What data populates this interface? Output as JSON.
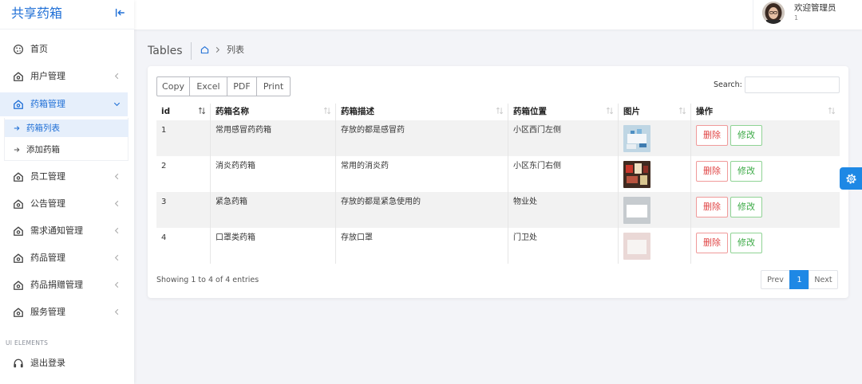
{
  "brand": {
    "title": "共享药箱"
  },
  "sidebar": {
    "items": [
      {
        "label": "首页",
        "icon": "palette-icon",
        "has_submenu": false
      },
      {
        "label": "用户管理",
        "icon": "home-icon",
        "has_submenu": true
      },
      {
        "label": "药箱管理",
        "icon": "home-icon",
        "has_submenu": true,
        "active": true,
        "expanded": true,
        "children": [
          {
            "label": "药箱列表",
            "active": true
          },
          {
            "label": "添加药箱",
            "active": false
          }
        ]
      },
      {
        "label": "员工管理",
        "icon": "home-icon",
        "has_submenu": true
      },
      {
        "label": "公告管理",
        "icon": "home-icon",
        "has_submenu": true
      },
      {
        "label": "需求通知管理",
        "icon": "home-icon",
        "has_submenu": true
      },
      {
        "label": "药品管理",
        "icon": "home-icon",
        "has_submenu": true
      },
      {
        "label": "药品捐赠管理",
        "icon": "home-icon",
        "has_submenu": true
      },
      {
        "label": "服务管理",
        "icon": "home-icon",
        "has_submenu": true
      }
    ],
    "section_label": "UI ELEMENTS",
    "logout": {
      "label": "退出登录",
      "icon": "headphones-icon"
    }
  },
  "header": {
    "welcome": "欢迎管理员",
    "user_id": "1",
    "avatar_icon": "user-avatar"
  },
  "page": {
    "title": "Tables",
    "breadcrumb": {
      "home_icon": "home-icon",
      "current": "列表"
    }
  },
  "toolbar": {
    "buttons": [
      "Copy",
      "Excel",
      "PDF",
      "Print"
    ],
    "search_label": "Search:"
  },
  "table": {
    "columns": [
      {
        "label": "id",
        "sorted": true
      },
      {
        "label": "药箱名称",
        "sorted": false
      },
      {
        "label": "药箱描述",
        "sorted": false
      },
      {
        "label": "药箱位置",
        "sorted": false
      },
      {
        "label": "图片",
        "sorted": false
      },
      {
        "label": "操作",
        "sorted": false
      }
    ],
    "rows": [
      {
        "id": "1",
        "name": "常用感冒药药箱",
        "description": "存放的都是感冒药",
        "location": "小区西门左侧"
      },
      {
        "id": "2",
        "name": "消炎药药箱",
        "description": "常用的消炎药",
        "location": "小区东门右侧"
      },
      {
        "id": "3",
        "name": "紧急药箱",
        "description": "存放的都是紧急使用的",
        "location": "物业处"
      },
      {
        "id": "4",
        "name": "口罩类药箱",
        "description": "存放口罩",
        "location": "门卫处"
      }
    ],
    "actions": {
      "delete": "删除",
      "edit": "修改"
    }
  },
  "pagination": {
    "info": "Showing 1 to 4 of 4 entries",
    "prev": "Prev",
    "current": "1",
    "next": "Next"
  },
  "colors": {
    "accent": "#1e88e5",
    "brand": "#1f6fd6",
    "delete": "#e04545",
    "edit": "#3daa47",
    "stripe": "#f2f2f2"
  }
}
